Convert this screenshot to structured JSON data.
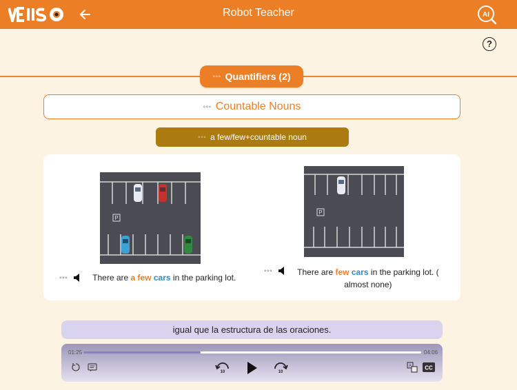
{
  "header": {
    "logo": "VEIISO",
    "title": "Robot Teacher",
    "ai_label": "AI"
  },
  "help": {
    "label": "?"
  },
  "lesson": {
    "section": "Quantifiers (2)",
    "topic": "Countable Nouns",
    "subtopic": "a few/few+countable noun",
    "dots": "◦◦◦"
  },
  "examples": [
    {
      "pre": "There are ",
      "quant": "a few",
      "noun": "cars",
      "post": " in the parking lot."
    },
    {
      "pre": "There are ",
      "quant": "few",
      "noun": "cars",
      "post": " in the parking lot. (",
      "post2": "almost none)"
    }
  ],
  "parking_sign": "P",
  "subtitle": "igual que la estructura de las oraciones.",
  "player": {
    "current_time": "01:25",
    "total_time": "04:06",
    "progress": 0.346,
    "rewind_label": "10",
    "forward_label": "10",
    "cc_label": "CC"
  },
  "colors": {
    "brand_orange": "#ec7f26",
    "subtopic_gold": "#ab7a11",
    "highlight_blue": "#3388c4",
    "background": "#fdf3e2"
  }
}
